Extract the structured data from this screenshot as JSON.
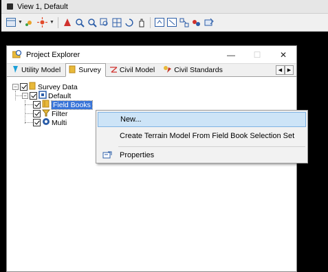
{
  "view_window": {
    "title": "View 1, Default"
  },
  "toolbar": {
    "icons": [
      "view-layout-icon",
      "dropdown-arrow-icon",
      "fit-view-icon",
      "brightness-icon",
      "dropdown-arrow-icon",
      "pointer-icon",
      "zoom-in-icon",
      "zoom-out-icon",
      "window-area-icon",
      "fit-view-icon",
      "rotate-view-icon",
      "pan-view-icon",
      "view-previous-icon",
      "view-next-icon",
      "view-attributes-icon",
      "presentation-icon",
      "model-icon"
    ]
  },
  "project_explorer": {
    "title": "Project Explorer",
    "controls": {
      "minimize": "—",
      "maximize": "☐",
      "close": "✕"
    },
    "tabs": [
      {
        "label": "Utility Model",
        "icon": "utility-icon"
      },
      {
        "label": "Survey",
        "icon": "survey-folder-icon",
        "active": true
      },
      {
        "label": "Civil Model",
        "icon": "civil-model-icon"
      },
      {
        "label": "Civil Standards",
        "icon": "civil-standards-icon"
      }
    ],
    "tab_scroll": {
      "left": "◀",
      "right": "▶"
    }
  },
  "tree": {
    "root": {
      "label": "Survey Data",
      "expander": "−"
    },
    "default_node": {
      "label": "Default",
      "expander": "−"
    },
    "children": [
      {
        "label": "Field Books",
        "selected": true
      },
      {
        "label": "Filter"
      },
      {
        "label": "Multi"
      }
    ]
  },
  "context_menu": {
    "items": [
      {
        "label": "New...",
        "hover": true
      },
      {
        "label": "Create Terrain Model From Field Book Selection Set"
      },
      {
        "label": "Properties",
        "icon": "properties-icon"
      }
    ]
  },
  "colors": {
    "selection": "#3874d8",
    "menu_hover": "#cde4f7",
    "folder": "#e8b93a"
  }
}
